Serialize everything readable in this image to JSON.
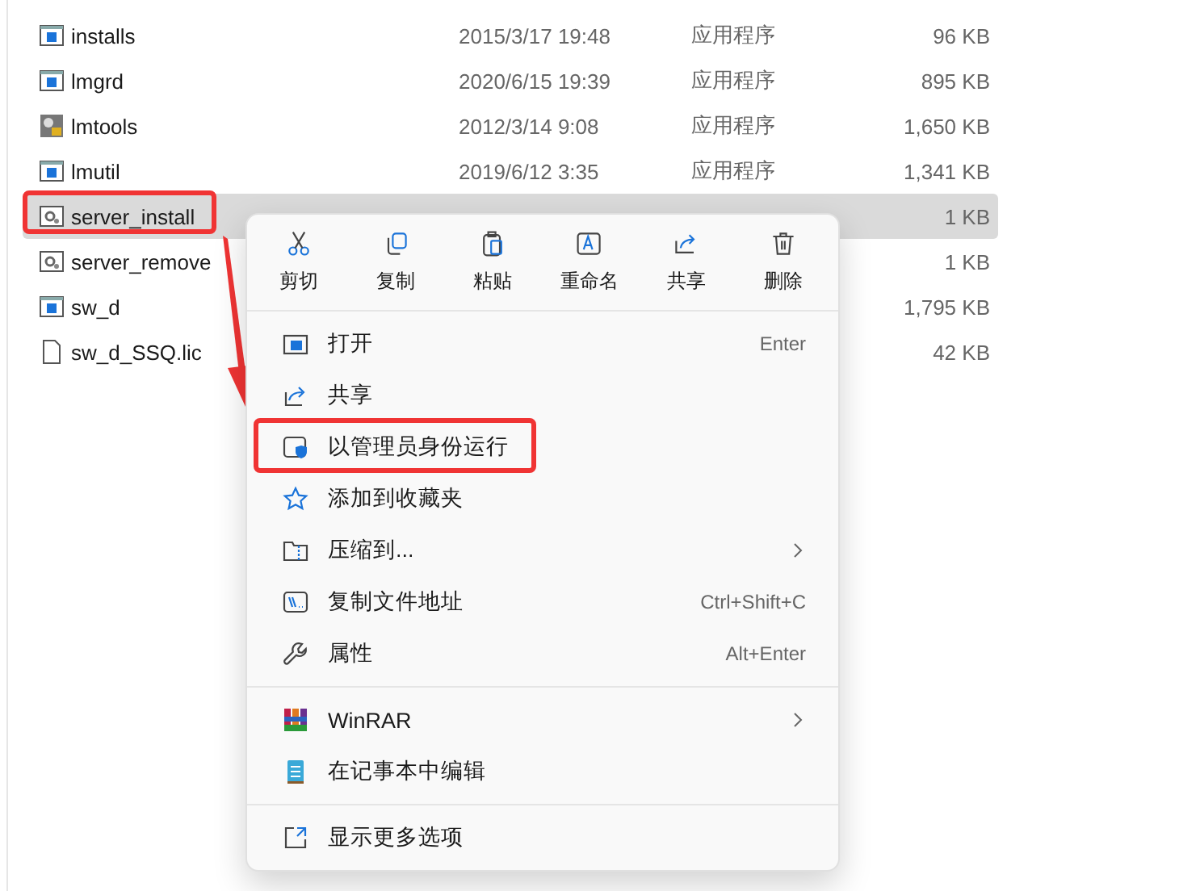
{
  "files": [
    {
      "name": "installs",
      "kind": "app",
      "modified": "2015/3/17 19:48",
      "type": "应用程序",
      "size": "96 KB",
      "selected": false,
      "annotated": false
    },
    {
      "name": "lmgrd",
      "kind": "app",
      "modified": "2020/6/15 19:39",
      "type": "应用程序",
      "size": "895 KB",
      "selected": false,
      "annotated": false
    },
    {
      "name": "lmtools",
      "kind": "tools",
      "modified": "2012/3/14 9:08",
      "type": "应用程序",
      "size": "1,650 KB",
      "selected": false,
      "annotated": false
    },
    {
      "name": "lmutil",
      "kind": "app",
      "modified": "2019/6/12 3:35",
      "type": "应用程序",
      "size": "1,341 KB",
      "selected": false,
      "annotated": false
    },
    {
      "name": "server_install",
      "kind": "script",
      "size": "1 KB",
      "selected": true,
      "annotated": true
    },
    {
      "name": "server_remove",
      "kind": "script",
      "size": "1 KB",
      "selected": false,
      "annotated": false
    },
    {
      "name": "sw_d",
      "kind": "app",
      "size": "1,795 KB",
      "selected": false,
      "annotated": false
    },
    {
      "name": "sw_d_SSQ.lic",
      "kind": "file",
      "size": "42 KB",
      "selected": false,
      "annotated": false
    }
  ],
  "context_menu": {
    "actions": [
      {
        "kind": "cut",
        "label": "剪切"
      },
      {
        "kind": "copy",
        "label": "复制"
      },
      {
        "kind": "paste",
        "label": "粘贴"
      },
      {
        "kind": "rename",
        "label": "重命名"
      },
      {
        "kind": "share",
        "label": "共享"
      },
      {
        "kind": "delete",
        "label": "删除"
      }
    ],
    "groups": [
      [
        {
          "kind": "open",
          "label": "打开",
          "shortcut": "Enter",
          "submenu": false,
          "annotated": false
        },
        {
          "kind": "share",
          "label": "共享",
          "submenu": false,
          "annotated": false
        },
        {
          "kind": "admin",
          "label": "以管理员身份运行",
          "submenu": false,
          "annotated": true
        },
        {
          "kind": "favorite",
          "label": "添加到收藏夹",
          "submenu": false,
          "annotated": false
        },
        {
          "kind": "compress",
          "label": "压缩到...",
          "submenu": true,
          "annotated": false
        },
        {
          "kind": "copypath",
          "label": "复制文件地址",
          "shortcut": "Ctrl+Shift+C",
          "submenu": false,
          "annotated": false
        },
        {
          "kind": "properties",
          "label": "属性",
          "shortcut": "Alt+Enter",
          "submenu": false,
          "annotated": false
        }
      ],
      [
        {
          "kind": "winrar",
          "label": "WinRAR",
          "submenu": true,
          "annotated": false
        },
        {
          "kind": "notepad",
          "label": "在记事本中编辑",
          "submenu": false,
          "annotated": false
        }
      ],
      [
        {
          "kind": "more",
          "label": "显示更多选项",
          "submenu": false,
          "annotated": false
        }
      ]
    ]
  }
}
